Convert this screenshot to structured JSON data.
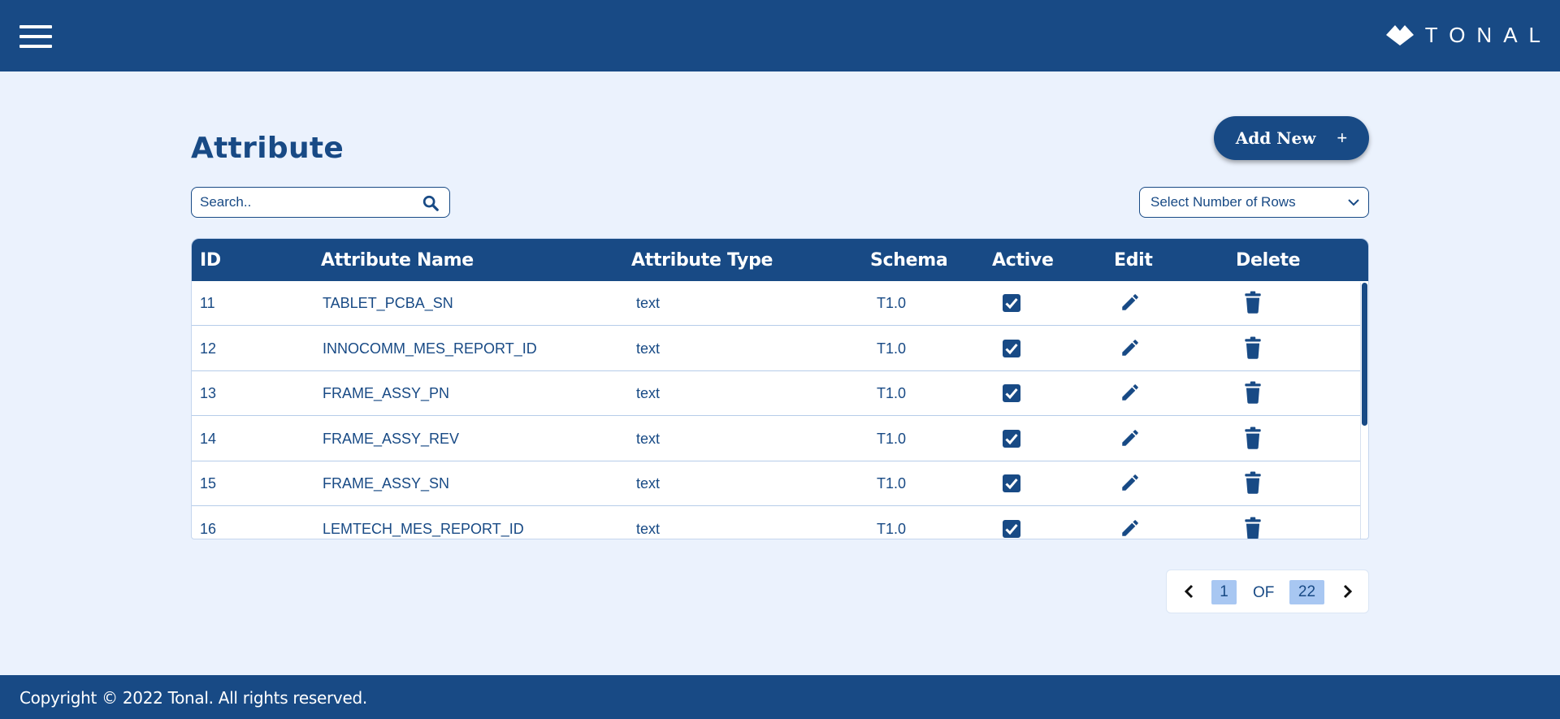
{
  "header": {
    "menu_icon": "hamburger-menu-icon",
    "logo_icon": "tonal-logo-mark",
    "logo_text": "TONAL"
  },
  "page": {
    "title": "Attribute",
    "add_button_label": "Add New",
    "add_button_icon": "+"
  },
  "search": {
    "placeholder": "Search..",
    "value": "",
    "icon": "search-icon"
  },
  "rows_select": {
    "selected": "Select Number of Rows",
    "icon": "chevron-down-icon"
  },
  "table": {
    "headers": {
      "id": "ID",
      "name": "Attribute Name",
      "type": "Attribute Type",
      "schema": "Schema",
      "active": "Active",
      "edit": "Edit",
      "delete": "Delete"
    },
    "rows": [
      {
        "id": "11",
        "name": "TABLET_PCBA_SN",
        "type": "text",
        "schema": "T1.0",
        "active": true
      },
      {
        "id": "12",
        "name": "INNOCOMM_MES_REPORT_ID",
        "type": "text",
        "schema": "T1.0",
        "active": true
      },
      {
        "id": "13",
        "name": "FRAME_ASSY_PN",
        "type": "text",
        "schema": "T1.0",
        "active": true
      },
      {
        "id": "14",
        "name": "FRAME_ASSY_REV",
        "type": "text",
        "schema": "T1.0",
        "active": true
      },
      {
        "id": "15",
        "name": "FRAME_ASSY_SN",
        "type": "text",
        "schema": "T1.0",
        "active": true
      },
      {
        "id": "16",
        "name": "LEMTECH_MES_REPORT_ID",
        "type": "text",
        "schema": "T1.0",
        "active": true
      }
    ]
  },
  "pagination": {
    "current": "1",
    "of_label": "OF",
    "total": "22"
  },
  "footer": {
    "copyright": "Copyright © 2022 Tonal. All rights reserved."
  },
  "colors": {
    "primary": "#184a85",
    "background": "#ebf2fd",
    "page_highlight": "#a8c7f2"
  }
}
